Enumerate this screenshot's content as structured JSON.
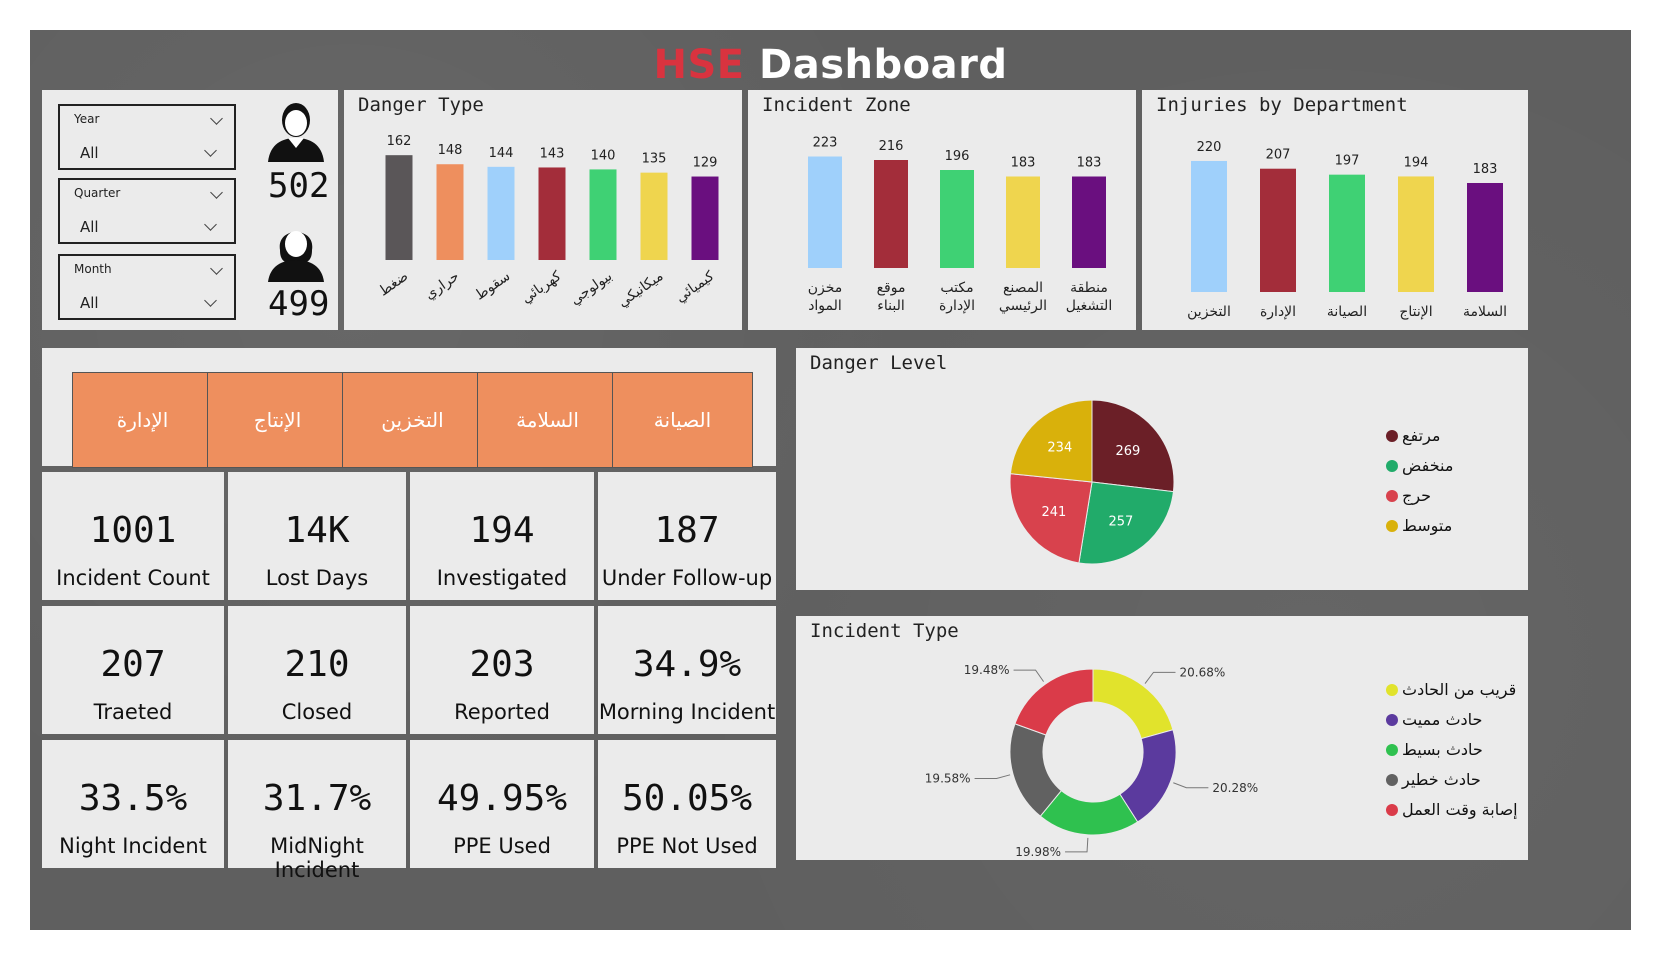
{
  "title": {
    "accent": "HSE",
    "rest": " Dashboard"
  },
  "filters": [
    {
      "label": "Year",
      "value": "All"
    },
    {
      "label": "Quarter",
      "value": "All"
    },
    {
      "label": "Month",
      "value": "All"
    }
  ],
  "people": {
    "male_count": "502",
    "female_count": "499"
  },
  "departments": [
    "الإدارة",
    "الإنتاج",
    "التخزين",
    "السلامة",
    "الصيانة"
  ],
  "kpis": [
    {
      "value": "1001",
      "label": "Incident Count"
    },
    {
      "value": "14K",
      "label": "Lost Days"
    },
    {
      "value": "194",
      "label": "Investigated"
    },
    {
      "value": "187",
      "label": "Under Follow-up"
    },
    {
      "value": "207",
      "label": "Traeted"
    },
    {
      "value": "210",
      "label": "Closed"
    },
    {
      "value": "203",
      "label": "Reported"
    },
    {
      "value": "34.9%",
      "label": "Morning Incident"
    },
    {
      "value": "33.5%",
      "label": "Night Incident"
    },
    {
      "value": "31.7%",
      "label": "MidNight Incident"
    },
    {
      "value": "49.95%",
      "label": "PPE Used"
    },
    {
      "value": "50.05%",
      "label": "PPE Not Used"
    }
  ],
  "colors": {
    "dark_gray": "#5a5658",
    "orange": "#ee8f5e",
    "light_blue": "#9fd0fb",
    "dark_red": "#a32d3a",
    "green": "#3fd174",
    "yellow": "#efd54e",
    "purple": "#6a0f7f"
  },
  "chart_data": [
    {
      "type": "bar",
      "title": "Danger Type",
      "categories": [
        "ضغط",
        "حراري",
        "سقوط",
        "كهربائي",
        "بيولوجي",
        "ميكانيكي",
        "كيميائي"
      ],
      "values": [
        162,
        148,
        144,
        143,
        140,
        135,
        129
      ],
      "colors": [
        "#5a5658",
        "#ee8f5e",
        "#9fd0fb",
        "#a32d3a",
        "#3fd174",
        "#efd54e",
        "#6a0f7f"
      ],
      "ylim": [
        0,
        170
      ]
    },
    {
      "type": "bar",
      "title": "Incident Zone",
      "categories": [
        "مخزن المواد",
        "موقع البناء",
        "مكتب الإدارة",
        "المصنع الرئيسي",
        "منطقة التشغيل"
      ],
      "values": [
        223,
        216,
        196,
        183,
        183
      ],
      "colors": [
        "#9fd0fb",
        "#a32d3a",
        "#3fd174",
        "#efd54e",
        "#6a0f7f"
      ],
      "ylim": [
        0,
        230
      ]
    },
    {
      "type": "bar",
      "title": "Injuries by Department",
      "categories": [
        "التخزين",
        "الإدارة",
        "الصيانة",
        "الإنتاج",
        "السلامة"
      ],
      "values": [
        220,
        207,
        197,
        194,
        183
      ],
      "colors": [
        "#9fd0fb",
        "#a32d3a",
        "#3fd174",
        "#efd54e",
        "#6a0f7f"
      ],
      "ylim": [
        0,
        230
      ]
    },
    {
      "type": "pie",
      "title": "Danger Level",
      "labels": [
        "مرتفع",
        "منخفض",
        "حرج",
        "متوسط"
      ],
      "values": [
        269,
        257,
        241,
        234
      ],
      "colors": [
        "#6b1f27",
        "#21ab6a",
        "#d8424d",
        "#d9b10b"
      ],
      "legend": "right"
    },
    {
      "type": "pie",
      "subtype": "donut",
      "title": "Incident Type",
      "labels": [
        "قريب من الحادث",
        "حادث مميت",
        "حادث بسيط",
        "حادث خطير",
        "إصابة وقت العمل"
      ],
      "values": [
        20.68,
        20.28,
        19.98,
        19.58,
        19.48
      ],
      "data_labels": [
        "20.68%",
        "20.28%",
        "19.98%",
        "19.58%",
        "19.48%"
      ],
      "colors": [
        "#e1e32c",
        "#5b3a9e",
        "#2fc14f",
        "#616161",
        "#da3b49"
      ],
      "legend": "right"
    }
  ]
}
